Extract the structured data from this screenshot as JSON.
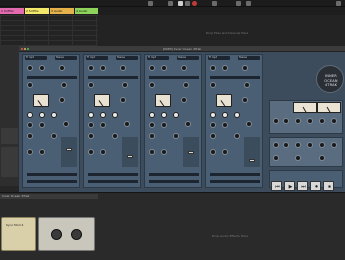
{
  "window": {
    "plugin_title": "[0083] Inner Ocean 4Trak"
  },
  "tracks": [
    {
      "name": "1 Sr/Fills",
      "color": "#e46ab0"
    },
    {
      "name": "2 Sr/Fills",
      "color": "#f3e86a"
    },
    {
      "name": "3 Audio",
      "color": "#e4b14a"
    },
    {
      "name": "4 Audio",
      "color": "#8fd45a"
    }
  ],
  "hints": {
    "drop_clips": "Drop Files and Devices Here",
    "drop_effects": "Drop Audio Effects Here"
  },
  "plugin": {
    "logo_lines": [
      "INNER",
      "OCEAN",
      "4TRAK"
    ],
    "channels": [
      {
        "input": "Tr Inpt",
        "mode": "Stereo"
      },
      {
        "input": "Tr Inpt",
        "mode": "Stereo"
      },
      {
        "input": "Tr Inpt",
        "mode": "Stereo"
      },
      {
        "input": "Tr Inpt",
        "mode": "Stereo"
      }
    ],
    "transport_symbols": [
      "⏮",
      "▶",
      "⏭",
      "⏺",
      "⏹"
    ]
  },
  "devices": {
    "title": "Inner Ocean 4Trak",
    "device_a_name": "Sync Mod 4",
    "colors": {
      "device_a": "#d9cfa8",
      "device_b": "#c9c6bb"
    }
  },
  "colors": {
    "accent": "#4a5f73",
    "plugin_bg": "#3c4c5c"
  }
}
